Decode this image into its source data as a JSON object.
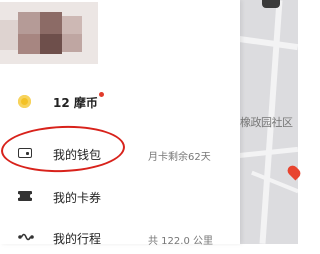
{
  "map": {
    "label": "橡政园社区"
  },
  "menu": {
    "coins": {
      "label": "12 摩币",
      "icon": "coin-icon",
      "has_notification_dot": true
    },
    "wallet": {
      "label": "我的钱包",
      "value": "月卡剩余62天",
      "icon": "wallet-icon"
    },
    "cards": {
      "label": "我的卡券",
      "icon": "ticket-icon"
    },
    "trips": {
      "label": "我的行程",
      "value": "共 122.0 公里",
      "icon": "route-icon"
    }
  },
  "colors": {
    "highlight": "#d8221b",
    "coin": "#f3c125",
    "notification": "#e13b2b"
  }
}
